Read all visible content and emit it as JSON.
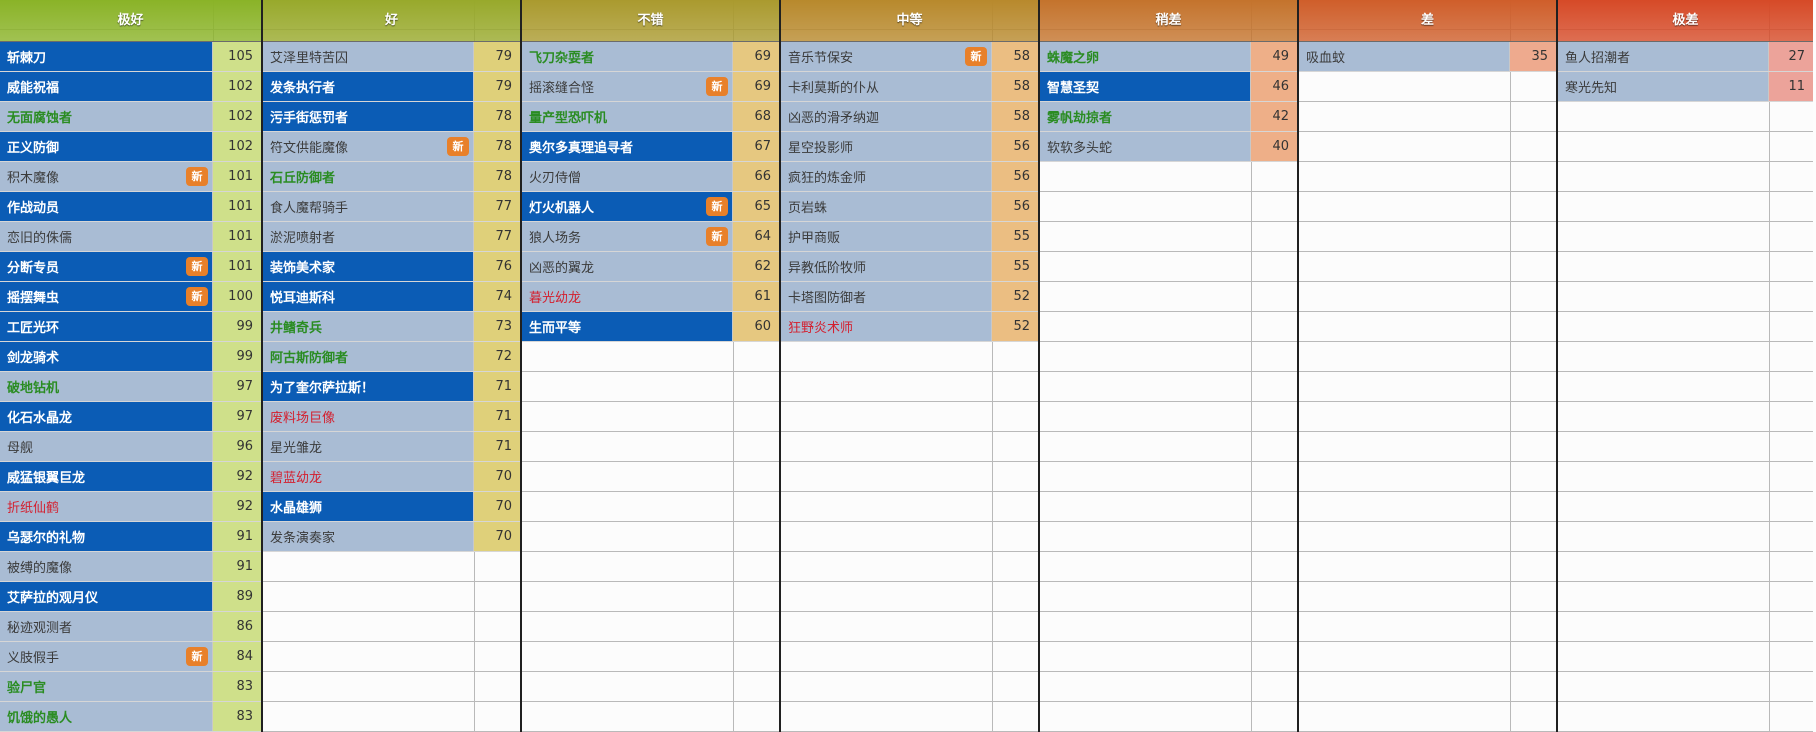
{
  "tiers": [
    {
      "label": "极好",
      "header_color": "#8ab327",
      "score_color": "#cfe08a",
      "entries": [
        {
          "name": "斩棘刀",
          "score": "105",
          "bg": "dark",
          "text": "white",
          "new": false
        },
        {
          "name": "威能祝福",
          "score": "102",
          "bg": "dark",
          "text": "white",
          "new": false
        },
        {
          "name": "无面腐蚀者",
          "score": "102",
          "bg": "light",
          "text": "green",
          "new": false
        },
        {
          "name": "正义防御",
          "score": "102",
          "bg": "dark",
          "text": "white",
          "new": false
        },
        {
          "name": "积木魔像",
          "score": "101",
          "bg": "light",
          "text": "gray",
          "new": true
        },
        {
          "name": "作战动员",
          "score": "101",
          "bg": "dark",
          "text": "white",
          "new": false
        },
        {
          "name": "恋旧的侏儒",
          "score": "101",
          "bg": "light",
          "text": "gray",
          "new": false
        },
        {
          "name": "分断专员",
          "score": "101",
          "bg": "dark",
          "text": "white",
          "new": true
        },
        {
          "name": "摇摆舞虫",
          "score": "100",
          "bg": "dark",
          "text": "white",
          "new": true
        },
        {
          "name": "工匠光环",
          "score": "99",
          "bg": "dark",
          "text": "white",
          "new": false
        },
        {
          "name": "剑龙骑术",
          "score": "99",
          "bg": "dark",
          "text": "white",
          "new": false
        },
        {
          "name": "破地钻机",
          "score": "97",
          "bg": "light",
          "text": "green",
          "new": false
        },
        {
          "name": "化石水晶龙",
          "score": "97",
          "bg": "dark",
          "text": "white",
          "new": false
        },
        {
          "name": "母舰",
          "score": "96",
          "bg": "light",
          "text": "gray",
          "new": false
        },
        {
          "name": "威猛银翼巨龙",
          "score": "92",
          "bg": "dark",
          "text": "white",
          "new": false
        },
        {
          "name": "折纸仙鹤",
          "score": "92",
          "bg": "light",
          "text": "red",
          "new": false
        },
        {
          "name": "乌瑟尔的礼物",
          "score": "91",
          "bg": "dark",
          "text": "white",
          "new": false
        },
        {
          "name": "被缚的魔像",
          "score": "91",
          "bg": "light",
          "text": "gray",
          "new": false
        },
        {
          "name": "艾萨拉的观月仪",
          "score": "89",
          "bg": "dark",
          "text": "white",
          "new": false
        },
        {
          "name": "秘迹观测者",
          "score": "86",
          "bg": "light",
          "text": "gray",
          "new": false
        },
        {
          "name": "义肢假手",
          "score": "84",
          "bg": "light",
          "text": "gray",
          "new": true
        },
        {
          "name": "验尸官",
          "score": "83",
          "bg": "light",
          "text": "green",
          "new": false
        },
        {
          "name": "饥饿的愚人",
          "score": "83",
          "bg": "light",
          "text": "green",
          "new": false
        }
      ]
    },
    {
      "label": "好",
      "header_color": "#98a92b",
      "score_color": "#dfd07a",
      "entries": [
        {
          "name": "艾泽里特苦囚",
          "score": "79",
          "bg": "light",
          "text": "gray",
          "new": false
        },
        {
          "name": "发条执行者",
          "score": "79",
          "bg": "dark",
          "text": "white",
          "new": false
        },
        {
          "name": "污手街惩罚者",
          "score": "78",
          "bg": "dark",
          "text": "white",
          "new": false
        },
        {
          "name": "符文供能魔像",
          "score": "78",
          "bg": "light",
          "text": "gray",
          "new": true
        },
        {
          "name": "石丘防御者",
          "score": "78",
          "bg": "light",
          "text": "green",
          "new": false
        },
        {
          "name": "食人魔帮骑手",
          "score": "77",
          "bg": "light",
          "text": "gray",
          "new": false
        },
        {
          "name": "淤泥喷射者",
          "score": "77",
          "bg": "light",
          "text": "gray",
          "new": false
        },
        {
          "name": "装饰美术家",
          "score": "76",
          "bg": "dark",
          "text": "white",
          "new": false
        },
        {
          "name": "悦耳迪斯科",
          "score": "74",
          "bg": "dark",
          "text": "white",
          "new": false
        },
        {
          "name": "井鳍奇兵",
          "score": "73",
          "bg": "light",
          "text": "green",
          "new": false
        },
        {
          "name": "阿古斯防御者",
          "score": "72",
          "bg": "light",
          "text": "green",
          "new": false
        },
        {
          "name": "为了奎尔萨拉斯！",
          "score": "71",
          "bg": "dark",
          "text": "white",
          "new": false
        },
        {
          "name": "废料场巨像",
          "score": "71",
          "bg": "light",
          "text": "red",
          "new": false
        },
        {
          "name": "星光雏龙",
          "score": "71",
          "bg": "light",
          "text": "gray",
          "new": false
        },
        {
          "name": "碧蓝幼龙",
          "score": "70",
          "bg": "light",
          "text": "red",
          "new": false
        },
        {
          "name": "水晶雄狮",
          "score": "70",
          "bg": "dark",
          "text": "white",
          "new": false
        },
        {
          "name": "发条演奏家",
          "score": "70",
          "bg": "light",
          "text": "gray",
          "new": false
        }
      ]
    },
    {
      "label": "不错",
      "header_color": "#aa9a2e",
      "score_color": "#e6c880",
      "entries": [
        {
          "name": "飞刀杂耍者",
          "score": "69",
          "bg": "light",
          "text": "green",
          "new": false
        },
        {
          "name": "摇滚缝合怪",
          "score": "69",
          "bg": "light",
          "text": "gray",
          "new": true
        },
        {
          "name": "量产型恐吓机",
          "score": "68",
          "bg": "light",
          "text": "green",
          "new": false
        },
        {
          "name": "奥尔多真理追寻者",
          "score": "67",
          "bg": "dark",
          "text": "white",
          "new": false
        },
        {
          "name": "火刃侍僧",
          "score": "66",
          "bg": "light",
          "text": "gray",
          "new": false
        },
        {
          "name": "灯火机器人",
          "score": "65",
          "bg": "dark",
          "text": "white",
          "new": true
        },
        {
          "name": "狼人场务",
          "score": "64",
          "bg": "light",
          "text": "gray",
          "new": true
        },
        {
          "name": "凶恶的翼龙",
          "score": "62",
          "bg": "light",
          "text": "gray",
          "new": false
        },
        {
          "name": "暮光幼龙",
          "score": "61",
          "bg": "light",
          "text": "red",
          "new": false
        },
        {
          "name": "生而平等",
          "score": "60",
          "bg": "dark",
          "text": "white",
          "new": false
        }
      ]
    },
    {
      "label": "中等",
      "header_color": "#b8892c",
      "score_color": "#ebbe82",
      "entries": [
        {
          "name": "音乐节保安",
          "score": "58",
          "bg": "light",
          "text": "gray",
          "new": true
        },
        {
          "name": "卡利莫斯的仆从",
          "score": "58",
          "bg": "light",
          "text": "gray",
          "new": false
        },
        {
          "name": "凶恶的滑矛纳迦",
          "score": "58",
          "bg": "light",
          "text": "gray",
          "new": false
        },
        {
          "name": "星空投影师",
          "score": "56",
          "bg": "light",
          "text": "gray",
          "new": false
        },
        {
          "name": "疯狂的炼金师",
          "score": "56",
          "bg": "light",
          "text": "gray",
          "new": false
        },
        {
          "name": "页岩蛛",
          "score": "56",
          "bg": "light",
          "text": "gray",
          "new": false
        },
        {
          "name": "护甲商贩",
          "score": "55",
          "bg": "light",
          "text": "gray",
          "new": false
        },
        {
          "name": "异教低阶牧师",
          "score": "55",
          "bg": "light",
          "text": "gray",
          "new": false
        },
        {
          "name": "卡塔图防御者",
          "score": "52",
          "bg": "light",
          "text": "gray",
          "new": false
        },
        {
          "name": "狂野炎术师",
          "score": "52",
          "bg": "light",
          "text": "red",
          "new": false
        }
      ]
    },
    {
      "label": "稍差",
      "header_color": "#c4732c",
      "score_color": "#eeaf88",
      "entries": [
        {
          "name": "蛛魔之卵",
          "score": "49",
          "bg": "light",
          "text": "green",
          "new": false
        },
        {
          "name": "智慧圣契",
          "score": "46",
          "bg": "dark",
          "text": "white",
          "new": false
        },
        {
          "name": "雾帆劫掠者",
          "score": "42",
          "bg": "light",
          "text": "green",
          "new": false
        },
        {
          "name": "软软多头蛇",
          "score": "40",
          "bg": "light",
          "text": "gray",
          "new": false
        }
      ]
    },
    {
      "label": "差",
      "header_color": "#cf5e2a",
      "score_color": "#eeaa8e",
      "entries": [
        {
          "name": "吸血蚊",
          "score": "35",
          "bg": "light",
          "text": "gray",
          "new": false
        }
      ]
    },
    {
      "label": "极差",
      "header_color": "#d64a27",
      "score_color": "#eca39a",
      "entries": [
        {
          "name": "鱼人招潮者",
          "score": "27",
          "bg": "light",
          "text": "gray",
          "new": false
        },
        {
          "name": "寒光先知",
          "score": "11",
          "bg": "light",
          "text": "gray",
          "new": false
        }
      ]
    }
  ],
  "badge_label": "新",
  "colors": {
    "bg_light": "#a9bcd4",
    "bg_dark": "#0b5cb5",
    "text_white": "#ffffff",
    "text_green": "#2a8c22",
    "text_red": "#d41f2e",
    "text_gray": "#3b3b3b",
    "badge": "#e8802a"
  }
}
